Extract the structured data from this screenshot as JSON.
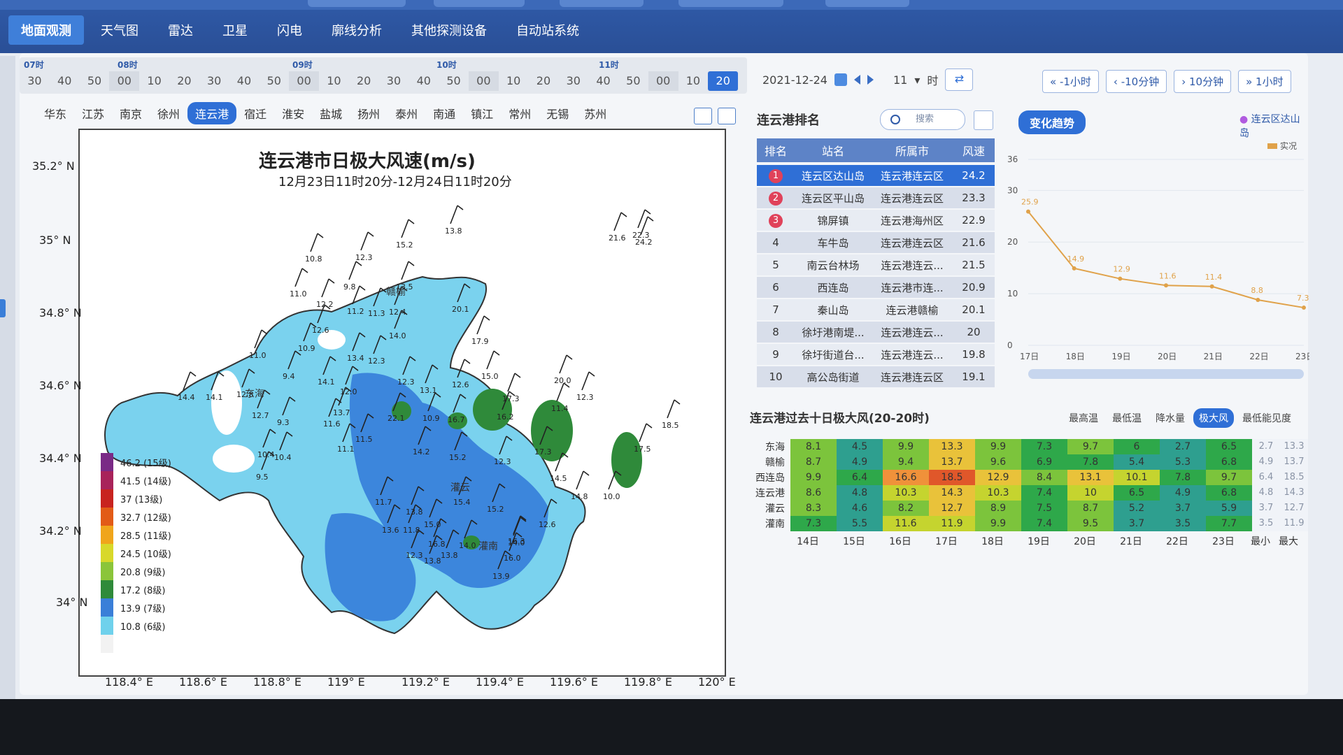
{
  "nav": {
    "items": [
      "地面观测",
      "天气图",
      "雷达",
      "卫星",
      "闪电",
      "廓线分析",
      "其他探测设备",
      "自动站系统"
    ],
    "active_index": 0
  },
  "timeline": {
    "hour_labels": [
      "07时",
      "08时",
      "09时",
      "10时",
      "11时"
    ],
    "ticks": [
      "30",
      "40",
      "50",
      "00",
      "10",
      "20",
      "30",
      "40",
      "50",
      "00",
      "10",
      "20",
      "30",
      "40",
      "50",
      "00",
      "10",
      "20",
      "30",
      "40",
      "50",
      "00",
      "10",
      "20"
    ],
    "active_tick_index": 23,
    "date": "2021-12-24",
    "hour_value": "11",
    "hour_unit": "时",
    "steps": [
      "-1小时",
      "-10分钟",
      "10分钟",
      "1小时"
    ]
  },
  "cities": [
    "华东",
    "江苏",
    "南京",
    "徐州",
    "连云港",
    "宿迁",
    "淮安",
    "盐城",
    "扬州",
    "泰州",
    "南通",
    "镇江",
    "常州",
    "无锡",
    "苏州"
  ],
  "active_city_index": 4,
  "map": {
    "title": "连云港市日极大风速(m/s)",
    "subtitle": "12月23日11时20分-12月24日11时20分",
    "y_labels": [
      "35.2° N",
      "35° N",
      "34.8° N",
      "34.6° N",
      "34.4° N",
      "34.2° N",
      "34° N"
    ],
    "x_labels": [
      "118.4° E",
      "118.6° E",
      "118.8° E",
      "119° E",
      "119.2° E",
      "119.4° E",
      "119.6° E",
      "119.8° E",
      "120° E"
    ],
    "place_labels": [
      "东海",
      "赣榆",
      "灌云",
      "灌南"
    ],
    "station_values": [
      "15.2",
      "13.8",
      "10.8",
      "12.3",
      "9.8",
      "13.5",
      "11.0",
      "12.2",
      "11.2",
      "11.3",
      "12.4",
      "20.1",
      "12.6",
      "10.9",
      "14.0",
      "11.0",
      "13.4",
      "12.3",
      "17.9",
      "9.4",
      "14.1",
      "12.0",
      "13.1",
      "12.6",
      "15.0",
      "20.0",
      "12.3",
      "14.4",
      "14.1",
      "12.8",
      "12.7",
      "13.7",
      "22.1",
      "10.9",
      "16.7",
      "16.2",
      "17.3",
      "11.4",
      "12.3",
      "9.3",
      "11.6",
      "11.5",
      "14.2",
      "15.2",
      "17.3",
      "18.5",
      "10.4",
      "10.4",
      "11.1",
      "12.3",
      "14.5",
      "14.8",
      "10.0",
      "9.5",
      "11.7",
      "13.8",
      "15.4",
      "15.2",
      "12.6",
      "13.6",
      "11.8",
      "15.0",
      "16.8",
      "14.0",
      "14.0",
      "12.3",
      "13.8",
      "13.8",
      "13.9",
      "16.0",
      "16.3",
      "21.6",
      "22.3",
      "24.2",
      "17.5"
    ],
    "legend": [
      {
        "label": "46.2 (15级)",
        "color": "#7a2a86"
      },
      {
        "label": "41.5 (14级)",
        "color": "#a8235a"
      },
      {
        "label": "37 (13级)",
        "color": "#c8231f"
      },
      {
        "label": "32.7 (12级)",
        "color": "#e25b17"
      },
      {
        "label": "28.5 (11级)",
        "color": "#f0a51b"
      },
      {
        "label": "24.5 (10级)",
        "color": "#d8d82a"
      },
      {
        "label": "20.8 (9级)",
        "color": "#8bc53a"
      },
      {
        "label": "17.2 (8级)",
        "color": "#2f8a3a"
      },
      {
        "label": "13.9 (7级)",
        "color": "#3a7fd8"
      },
      {
        "label": "10.8 (6级)",
        "color": "#6fd1ec"
      },
      {
        "label": "",
        "color": "#f2f2f2"
      }
    ]
  },
  "ranking": {
    "title": "连云港排名",
    "search_placeholder": "搜索",
    "headers": [
      "排名",
      "站名",
      "所属市",
      "风速"
    ],
    "rows": [
      {
        "rank": "1",
        "name": "连云区达山岛",
        "district": "连云港连云区",
        "wind": "24.2"
      },
      {
        "rank": "2",
        "name": "连云区平山岛",
        "district": "连云港连云区",
        "wind": "23.3"
      },
      {
        "rank": "3",
        "name": "锦屏镇",
        "district": "连云港海州区",
        "wind": "22.9"
      },
      {
        "rank": "4",
        "name": "车牛岛",
        "district": "连云港连云区",
        "wind": "21.6"
      },
      {
        "rank": "5",
        "name": "南云台林场",
        "district": "连云港连云...",
        "wind": "21.5"
      },
      {
        "rank": "6",
        "name": "西连岛",
        "district": "连云港市连...",
        "wind": "20.9"
      },
      {
        "rank": "7",
        "name": "秦山岛",
        "district": "连云港赣榆",
        "wind": "20.1"
      },
      {
        "rank": "8",
        "name": "徐圩港南堤...",
        "district": "连云港连云...",
        "wind": "20"
      },
      {
        "rank": "9",
        "name": "徐圩街道台...",
        "district": "连云港连云...",
        "wind": "19.8"
      },
      {
        "rank": "10",
        "name": "高公岛街道",
        "district": "连云港连云区",
        "wind": "19.1"
      }
    ]
  },
  "trend": {
    "tab": "变化趋势",
    "location": "连云区达山岛",
    "legend": "实况",
    "chart_data": {
      "type": "line",
      "categories": [
        "17日",
        "18日",
        "19日",
        "20日",
        "21日",
        "22日",
        "23日"
      ],
      "x": [
        "17日",
        "18日",
        "19日",
        "20日",
        "21日",
        "22日",
        "23日"
      ],
      "values": [
        25.9,
        14.9,
        12.9,
        11.6,
        11.4,
        8.8,
        7.3
      ],
      "value_labels": [
        "25.9",
        "14.9",
        "12.9",
        "11.6",
        "11.4",
        "8.8",
        "7.3"
      ],
      "y_ticks": [
        "0",
        "10",
        "20",
        "30",
        "36"
      ],
      "ylim": [
        0,
        36
      ],
      "series_name": "实况",
      "color": "#e0a24a"
    }
  },
  "heatmap": {
    "title": "连云港过去十日极大风(20-20时)",
    "tabs": [
      "最高温",
      "最低温",
      "降水量",
      "极大风",
      "最低能见度"
    ],
    "active_tab_index": 3,
    "rows": [
      {
        "name": "东海",
        "values": [
          "8.1",
          "4.5",
          "9.9",
          "13.3",
          "9.9",
          "7.3",
          "9.7",
          "6",
          "2.7",
          "6.5"
        ],
        "min": "2.7",
        "max": "13.3"
      },
      {
        "name": "赣榆",
        "values": [
          "8.7",
          "4.9",
          "9.4",
          "13.7",
          "9.6",
          "6.9",
          "7.8",
          "5.4",
          "5.3",
          "6.8"
        ],
        "min": "4.9",
        "max": "13.7"
      },
      {
        "name": "西连岛",
        "values": [
          "9.9",
          "6.4",
          "16.6",
          "18.5",
          "12.9",
          "8.4",
          "13.1",
          "10.1",
          "7.8",
          "9.7"
        ],
        "min": "6.4",
        "max": "18.5"
      },
      {
        "name": "连云港",
        "values": [
          "8.6",
          "4.8",
          "10.3",
          "14.3",
          "10.3",
          "7.4",
          "10",
          "6.5",
          "4.9",
          "6.8"
        ],
        "min": "4.8",
        "max": "14.3"
      },
      {
        "name": "灌云",
        "values": [
          "8.3",
          "4.6",
          "8.2",
          "12.7",
          "8.9",
          "7.5",
          "8.7",
          "5.2",
          "3.7",
          "5.9"
        ],
        "min": "3.7",
        "max": "12.7"
      },
      {
        "name": "灌南",
        "values": [
          "7.3",
          "5.5",
          "11.6",
          "11.9",
          "9.9",
          "7.4",
          "9.5",
          "3.7",
          "3.5",
          "7.7"
        ],
        "min": "3.5",
        "max": "11.9"
      }
    ],
    "days": [
      "14日",
      "15日",
      "16日",
      "17日",
      "18日",
      "19日",
      "20日",
      "21日",
      "22日",
      "23日",
      "最小",
      "最大"
    ]
  }
}
